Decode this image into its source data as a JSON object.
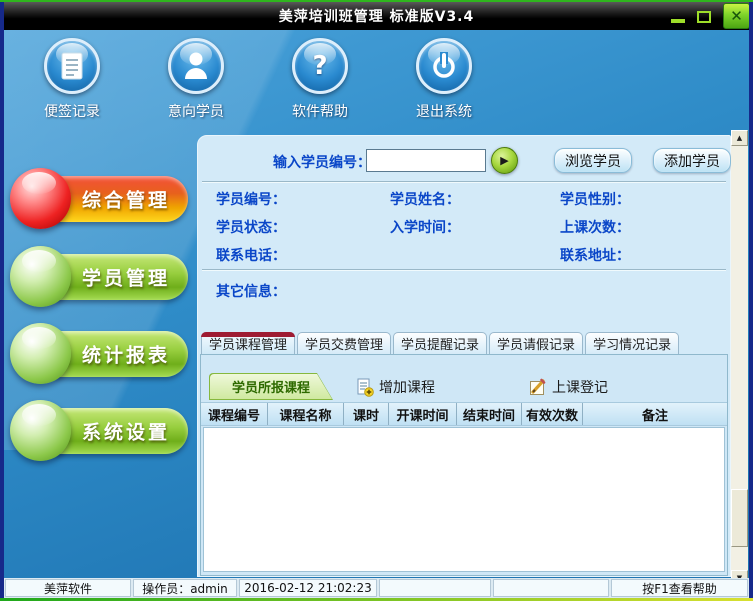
{
  "window": {
    "title": "美萍培训班管理  标准版V3.4",
    "controls": {
      "minimize_icon": "minimize",
      "maximize_icon": "maximize",
      "close_glyph": "✕"
    }
  },
  "toolbar": {
    "items": [
      {
        "label": "便签记录",
        "icon": "note-icon"
      },
      {
        "label": "意向学员",
        "icon": "person-icon"
      },
      {
        "label": "软件帮助",
        "icon": "question-icon",
        "glyph": "?"
      },
      {
        "label": "退出系统",
        "icon": "power-icon"
      }
    ]
  },
  "sidebar": {
    "items": [
      {
        "label": "综合管理",
        "color": "red",
        "active": true
      },
      {
        "label": "学员管理",
        "color": "green",
        "active": false
      },
      {
        "label": "统计报表",
        "color": "green",
        "active": false
      },
      {
        "label": "系统设置",
        "color": "green",
        "active": false
      }
    ]
  },
  "search": {
    "label": "输入学员编号：",
    "value": "",
    "go_glyph": "▶",
    "browse_button": "浏览学员",
    "add_button": "添加学员"
  },
  "student_form": {
    "fields": [
      {
        "label": "学员编号：",
        "value": ""
      },
      {
        "label": "学员姓名：",
        "value": ""
      },
      {
        "label": "学员性别：",
        "value": ""
      },
      {
        "label": "学员状态：",
        "value": ""
      },
      {
        "label": "入学时间：",
        "value": ""
      },
      {
        "label": "上课次数：",
        "value": ""
      },
      {
        "label": "联系电话：",
        "value": ""
      },
      {
        "label": "联系地址：",
        "value": ""
      }
    ],
    "other_info_label": "其它信息："
  },
  "tabs": [
    {
      "label": "学员课程管理",
      "active": true
    },
    {
      "label": "学员交费管理",
      "active": false
    },
    {
      "label": "学员提醒记录",
      "active": false
    },
    {
      "label": "学员请假记录",
      "active": false
    },
    {
      "label": "学习情况记录",
      "active": false
    }
  ],
  "course_panel": {
    "section_tab": "学员所报课程",
    "add_course_label": "增加课程",
    "register_label": "上课登记",
    "table": {
      "columns": [
        "课程编号",
        "课程名称",
        "课时",
        "开课时间",
        "结束时间",
        "有效次数",
        "备注"
      ],
      "rows": []
    }
  },
  "scrollbar": {
    "up_glyph": "▲",
    "down_glyph": "▼"
  },
  "statusbar": {
    "cells": [
      "美萍软件",
      "操作员：admin",
      "2016-02-12 21:02:23",
      "",
      "",
      "按F1查看帮助"
    ]
  },
  "colors": {
    "window_border_green": "#2fb61e",
    "side_border_navy": "#16298a",
    "panel_bg": "#d3eaf8",
    "label_blue": "#0a46c8",
    "active_tab_red": "#9e1b32",
    "section_tab_green": "#cfe9a0",
    "sidebar_red": "#ee2222",
    "sidebar_green": "#8cc84a",
    "close_button_lime": "#7ed32a"
  }
}
